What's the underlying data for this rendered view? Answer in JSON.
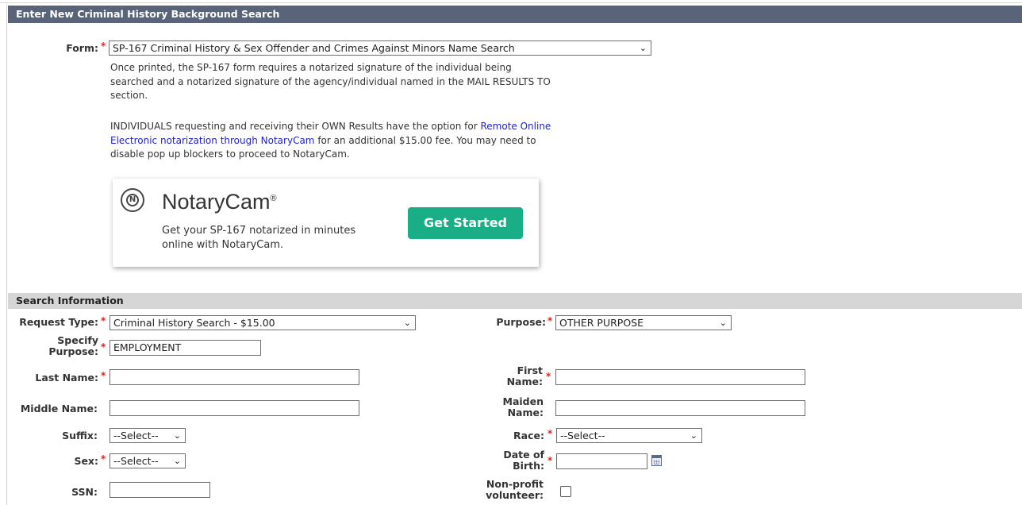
{
  "header": {
    "title": "Enter New Criminal History Background Search"
  },
  "form_field": {
    "label": "Form:",
    "value": "SP-167 Criminal History & Sex Offender and Crimes Against Minors Name Search",
    "note1": "Once printed, the SP-167 form requires a notarized signature of the individual being searched and a notarized signature of the agency/individual named in the MAIL RESULTS TO section.",
    "note2_line1": "INDIVIDUALS requesting and receiving their OWN Results have the option for",
    "note2_link": "Remote Online Electronic notarization through NotaryCam",
    "note2_tail": " for an additional $15.00 fee. You may need to disable pop up blockers to proceed to NotaryCam."
  },
  "notarycam": {
    "brand": "NotaryCam",
    "reg": "®",
    "subtitle": "Get your SP-167 notarized in minutes online with NotaryCam.",
    "button": "Get Started",
    "logo_letter": "N",
    "logo_icon": "notarycam-logo-icon"
  },
  "search_info": {
    "title": "Search Information",
    "request_type": {
      "label": "Request Type:",
      "value": "Criminal History Search - $15.00"
    },
    "purpose": {
      "label": "Purpose:",
      "value": "OTHER PURPOSE"
    },
    "specify_purpose": {
      "label_line1": "Specify",
      "label_line2": "Purpose:",
      "value": "EMPLOYMENT"
    },
    "last_name": {
      "label": "Last Name:",
      "value": ""
    },
    "first_name": {
      "label_line1": "First",
      "label_line2": "Name:",
      "value": ""
    },
    "middle_name": {
      "label": "Middle Name:",
      "value": ""
    },
    "maiden_name": {
      "label_line1": "Maiden",
      "label_line2": "Name:",
      "value": ""
    },
    "suffix": {
      "label": "Suffix:",
      "value": "--Select--"
    },
    "race": {
      "label": "Race:",
      "value": "--Select--"
    },
    "sex": {
      "label": "Sex:",
      "value": "--Select--"
    },
    "dob": {
      "label_line1": "Date of",
      "label_line2": "Birth:",
      "value": ""
    },
    "ssn": {
      "label": "SSN:",
      "value": ""
    },
    "nonprofit": {
      "label_line1": "Non-profit",
      "label_line2": "volunteer:",
      "checked": false
    }
  },
  "required_marker": "*",
  "chevron": "❯"
}
